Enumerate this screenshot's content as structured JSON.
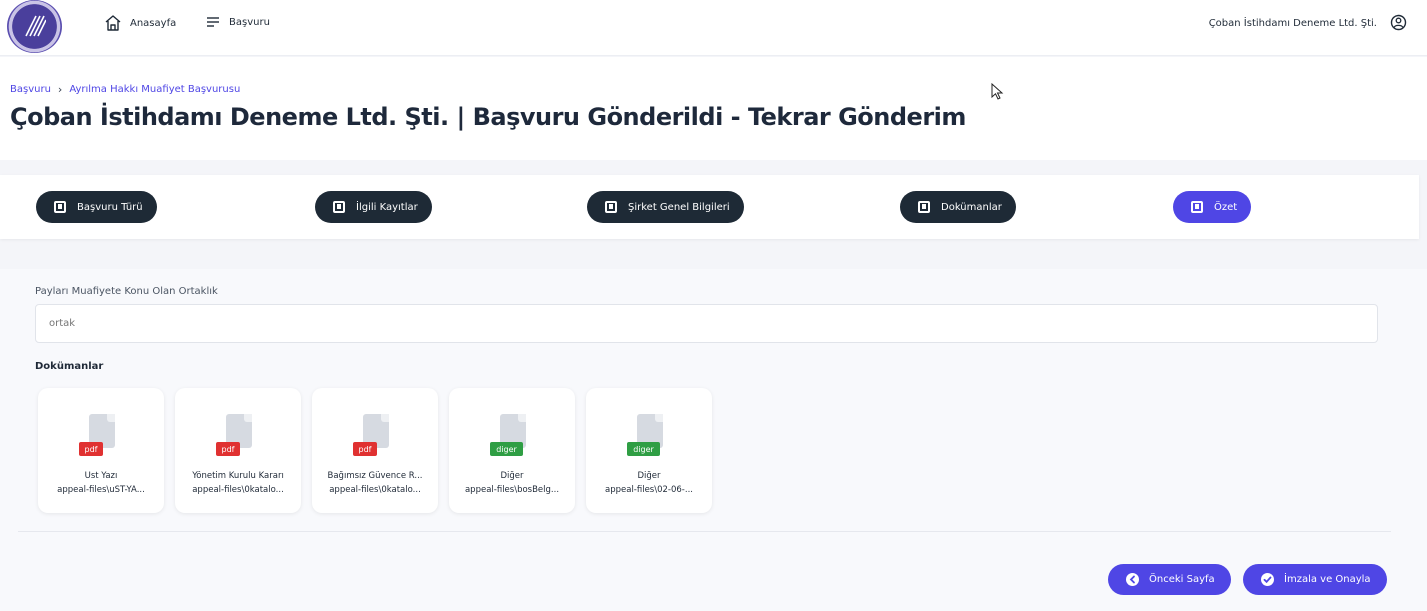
{
  "nav": {
    "home_label": "Anasayfa",
    "basvuru_label": "Başvuru",
    "user_name": "Çoban İstihdamı Deneme Ltd. Şti."
  },
  "header": {
    "breadcrumb": [
      "Başvuru",
      "Ayrılma Hakkı Muafiyet Başvurusu"
    ],
    "title": "Çoban İstihdamı Deneme Ltd. Şti. | Başvuru Gönderildi - Tekrar Gönderim"
  },
  "steps": [
    {
      "label": "Başvuru Türü",
      "active": false
    },
    {
      "label": "İlgili Kayıtlar",
      "active": false
    },
    {
      "label": "Şirket Genel Bilgileri",
      "active": false
    },
    {
      "label": "Dokümanlar",
      "active": false
    },
    {
      "label": "Özet",
      "active": true
    }
  ],
  "form": {
    "partnership_label": "Payları Muafiyete Konu Olan Ortaklık",
    "partnership_value": "ortak",
    "documents_title": "Dokümanlar"
  },
  "documents": [
    {
      "type": "pdf",
      "name": "Üst Yazı",
      "path": "appeal-files\\uST-YA..."
    },
    {
      "type": "pdf",
      "name": "Yönetim Kurulu Kararı",
      "path": "appeal-files\\0katalo..."
    },
    {
      "type": "pdf",
      "name": "Bağımsız Güvence R...",
      "path": "appeal-files\\0katalo..."
    },
    {
      "type": "diger",
      "name": "Diğer",
      "path": "appeal-files\\bosBelg..."
    },
    {
      "type": "diger",
      "name": "Diğer",
      "path": "appeal-files\\02-06-..."
    }
  ],
  "actions": {
    "previous_label": "Önceki Sayfa",
    "sign_label": "İmzala ve Onayla"
  },
  "colors": {
    "accent": "#4f46e5",
    "dark": "#1e2a36",
    "pdf_badge": "#e03131",
    "other_badge": "#2f9e44"
  }
}
